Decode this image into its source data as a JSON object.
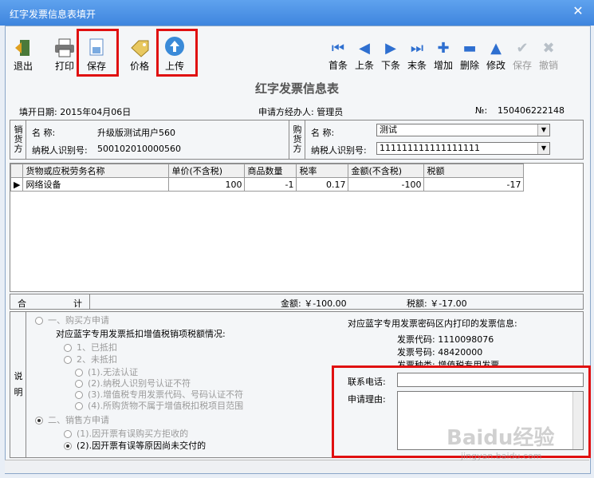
{
  "window": {
    "title": "红字发票信息表填开",
    "close_glyph": "✕"
  },
  "toolbar": {
    "exit": "退出",
    "print": "打印",
    "save": "保存",
    "price": "价格",
    "upload": "上传",
    "nav": [
      "首条",
      "上条",
      "下条",
      "末条",
      "增加",
      "删除",
      "修改",
      "保存",
      "撤销"
    ]
  },
  "form": {
    "title": "红字发票信息表",
    "fill_date": "填开日期: 2015年04月06日",
    "applicant": "申请方经办人: 管理员",
    "no_label": "№:",
    "no_value": "150406222148"
  },
  "seller": {
    "vlabel": [
      "销",
      "货",
      "方"
    ],
    "name_label": "名       称:",
    "name_value": "升级版测试用户560",
    "taxid_label": "纳税人识别号:",
    "taxid_value": "500102010000560"
  },
  "buyer": {
    "vlabel": [
      "购",
      "货",
      "方"
    ],
    "name_label": "名       称:",
    "name_value": "测试",
    "taxid_label": "纳税人识别号:",
    "taxid_value": "111111111111111111"
  },
  "grid": {
    "headers": [
      "货物或应税劳务名称",
      "单价(不含税)",
      "商品数量",
      "税率",
      "金额(不含税)",
      "税额"
    ],
    "rows": [
      [
        "网络设备",
        "100",
        "-1",
        "0.17",
        "-100",
        "-17"
      ]
    ]
  },
  "totals": {
    "label_he": "合",
    "label_ji": "计",
    "amount": "金额: ￥-100.00",
    "tax": "税额: ￥-17.00"
  },
  "explain": {
    "vlabel": [
      "说",
      "明"
    ],
    "buyer_apply": "一、购买方申请",
    "deduct_q": "对应蓝字专用发票抵扣增值税销项税额情况:",
    "opt1": "1、已抵扣",
    "opt2": "2、未抵扣",
    "sub1": "(1).无法认证",
    "sub2": "(2).纳税人识别号认证不符",
    "sub3": "(3).增值税专用发票代码、号码认证不符",
    "sub4": "(4).所购货物不属于增值税扣税项目范围",
    "seller_apply": "二、销售方申请",
    "s1": "(1).因开票有误购买方拒收的",
    "s2": "(2).因开票有误等原因尚未交付的",
    "blue_info": "对应蓝字专用发票密码区内打印的发票信息:",
    "inv_code": "发票代码: 1110098076",
    "inv_no": "发票号码: 48420000",
    "inv_type": "发票种类: 增值税专用发票",
    "phone_label": "联系电话:",
    "reason_label": "申请理由:"
  },
  "watermark": {
    "brand": "Baidu经验",
    "url": "jingyan.baidu.com"
  }
}
